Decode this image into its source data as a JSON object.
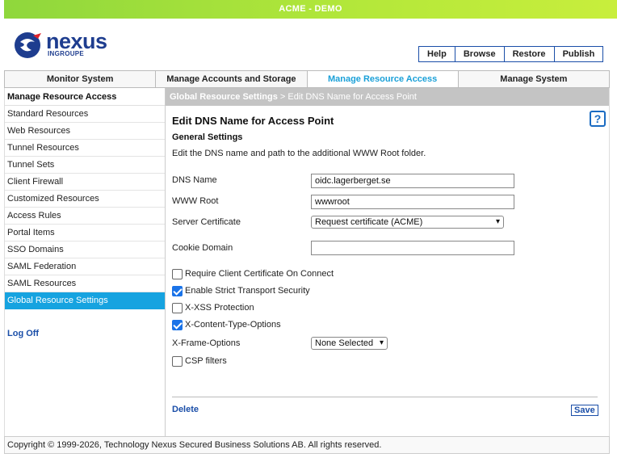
{
  "banner": "ACME - DEMO",
  "logo": {
    "word": "nexus",
    "sub": "INGROUPE"
  },
  "top_buttons": [
    "Help",
    "Browse",
    "Restore",
    "Publish"
  ],
  "main_nav": [
    {
      "label": "Monitor System",
      "active": false
    },
    {
      "label": "Manage Accounts and Storage",
      "active": false
    },
    {
      "label": "Manage Resource Access",
      "active": true
    },
    {
      "label": "Manage System",
      "active": false
    }
  ],
  "sidebar": {
    "heading": "Manage Resource Access",
    "items": [
      "Standard Resources",
      "Web Resources",
      "Tunnel Resources",
      "Tunnel Sets",
      "Client Firewall",
      "Customized Resources",
      "Access Rules",
      "Portal Items",
      "SSO Domains",
      "SAML Federation",
      "SAML Resources",
      "Global Resource Settings"
    ],
    "active_index": 11,
    "logoff": "Log Off"
  },
  "breadcrumb": {
    "parent": "Global Resource Settings",
    "sep": " > ",
    "current": "Edit DNS Name for Access Point"
  },
  "page": {
    "title": "Edit DNS Name for Access Point",
    "section": "General Settings",
    "description": "Edit the DNS name and path to the additional WWW Root folder.",
    "help": "?"
  },
  "form": {
    "dns_name": {
      "label": "DNS Name",
      "value": "oidc.lagerberget.se"
    },
    "www_root": {
      "label": "WWW Root",
      "value": "wwwroot"
    },
    "server_cert": {
      "label": "Server Certificate",
      "value": "Request certificate (ACME)"
    },
    "cookie_domain": {
      "label": "Cookie Domain",
      "value": ""
    },
    "checkboxes": [
      {
        "label": "Require Client Certificate On Connect",
        "checked": false
      },
      {
        "label": "Enable Strict Transport Security",
        "checked": true
      },
      {
        "label": "X-XSS Protection",
        "checked": false
      },
      {
        "label": "X-Content-Type-Options",
        "checked": true
      }
    ],
    "x_frame": {
      "label": "X-Frame-Options",
      "value": "None Selected"
    },
    "csp": {
      "label": "CSP filters",
      "checked": false
    }
  },
  "actions": {
    "delete": "Delete",
    "save": "Save"
  },
  "footer": "Copyright © 1999-2026, Technology Nexus Secured Business Solutions AB. All rights reserved.",
  "colors": {
    "accent": "#16a3e0",
    "link": "#1a4ea8",
    "banner": "#a6e23a"
  }
}
